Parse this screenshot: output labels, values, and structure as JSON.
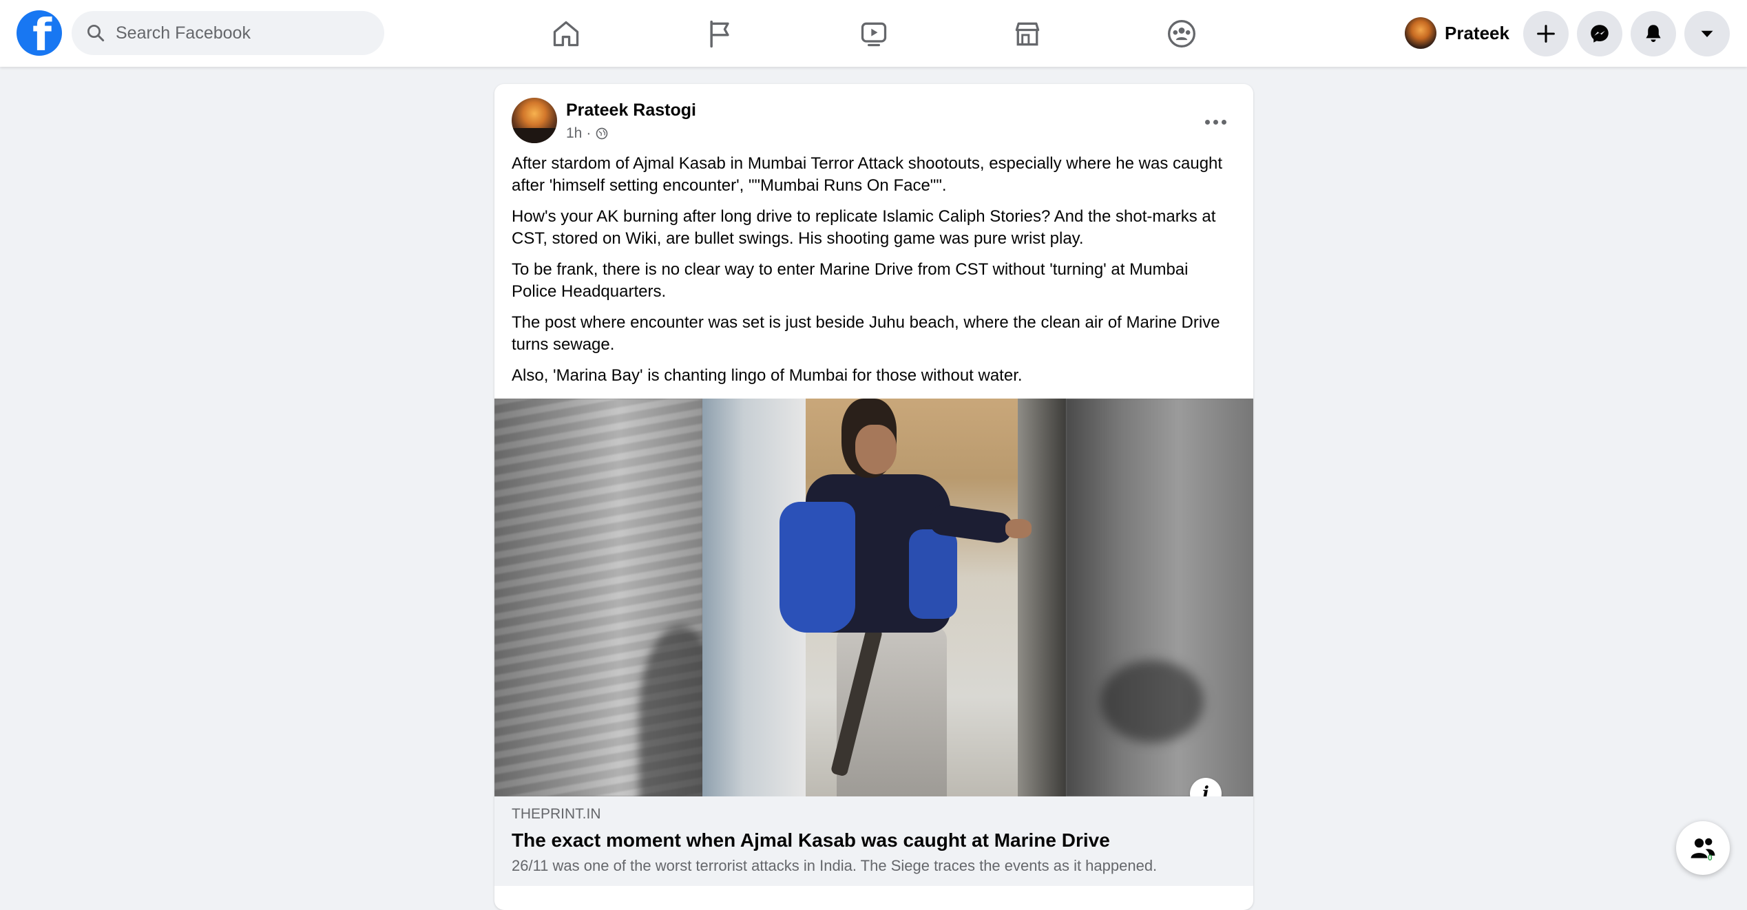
{
  "topbar": {
    "logo": "facebook-logo",
    "search_placeholder": "Search Facebook",
    "nav": [
      {
        "name": "home",
        "icon": "home-icon"
      },
      {
        "name": "pages",
        "icon": "flag-icon"
      },
      {
        "name": "watch",
        "icon": "video-icon"
      },
      {
        "name": "marketplace",
        "icon": "store-icon"
      },
      {
        "name": "groups",
        "icon": "groups-icon"
      }
    ],
    "profile_name": "Prateek",
    "buttons": [
      "create-icon",
      "messenger-icon",
      "notifications-icon",
      "account-menu-icon"
    ]
  },
  "post": {
    "author": "Prateek Rastogi",
    "time": "1h",
    "privacy_icon": "globe-icon",
    "paragraphs": [
      "After stardom of Ajmal Kasab in Mumbai Terror Attack shootouts, especially where he was caught after 'himself setting encounter', \"\"Mumbai Runs On Face\"\".",
      "How's your AK burning after long drive to replicate Islamic Caliph Stories? And the shot-marks at CST, stored on Wiki, are bullet swings. His shooting game was pure wrist play.",
      "To be frank, there is no clear way to enter Marine Drive from CST without 'turning' at Mumbai Police Headquarters.",
      "The post where encounter was set is just beside Juhu beach, where the clean air of Marine Drive turns sewage.",
      "Also, 'Marina Bay' is chanting lingo of Mumbai for those without water."
    ],
    "link": {
      "domain": "THEPRINT.IN",
      "title": "The exact moment when Ajmal Kasab was caught at Marine Drive",
      "description": "26/11 was one of the worst terrorist attacks in India. The Siege traces the events as it happened."
    },
    "info_label": "i"
  },
  "contacts_badge": "0",
  "colors": {
    "brand": "#1877f2",
    "background": "#f0f2f5",
    "secondary_text": "#65676b"
  }
}
